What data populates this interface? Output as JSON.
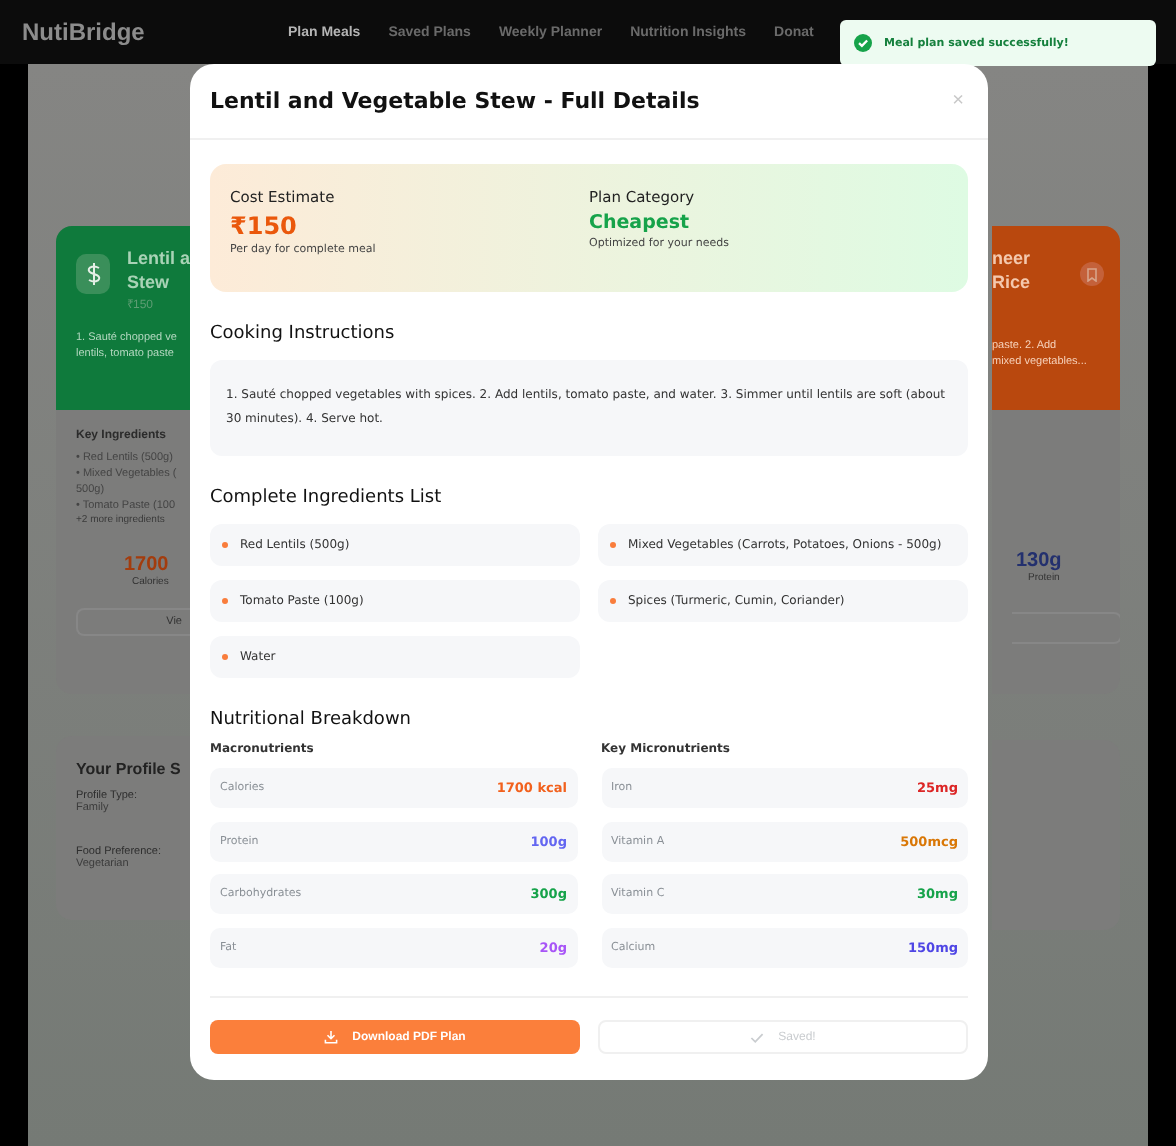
{
  "navbar": {
    "brand": "NutiBridge",
    "items": [
      {
        "label": "Plan Meals",
        "selected": true
      },
      {
        "label": "Saved Plans",
        "selected": false
      },
      {
        "label": "Weekly Planner",
        "selected": false
      },
      {
        "label": "Nutrition Insights",
        "selected": false
      },
      {
        "label": "Donat",
        "selected": false
      }
    ]
  },
  "background": {
    "left_card": {
      "title_lines": [
        "Lentil a",
        "Stew"
      ],
      "price": "₹150",
      "desc_lines": [
        "1. Sauté chopped ve",
        "lentils, tomato paste"
      ],
      "ingredients_title": "Key Ingredients",
      "ingredients": [
        "• Red Lentils (500g)",
        "• Mixed Vegetables (",
        "500g)",
        "• Tomato Paste (100"
      ],
      "more": "+2 more ingredients",
      "stat_value": "1700",
      "stat_label": "Calories",
      "button": "Vie"
    },
    "profile_card": {
      "title": "Your Profile S",
      "fields": [
        {
          "label": "Profile Type:",
          "value": "Family"
        },
        {
          "label": "Food Preference:",
          "value": "Vegetarian"
        }
      ]
    },
    "right_card": {
      "title_lines": [
        "neer",
        "Rice"
      ],
      "desc_lines": [
        "paste. 2. Add",
        "mixed vegetables..."
      ],
      "stat_value": "130g",
      "stat_label": "Protein"
    }
  },
  "toast": {
    "message": "Meal plan saved successfully!"
  },
  "modal": {
    "title": "Lentil and Vegetable Stew - Full Details",
    "close": "×",
    "summary": [
      {
        "label": "Cost Estimate",
        "value": "₹150",
        "note": "Per day for complete meal",
        "kind": "cost"
      },
      {
        "label": "Plan Category",
        "value": "Cheapest",
        "note": "Optimized for your needs",
        "kind": "category"
      }
    ],
    "instructions_title": "Cooking Instructions",
    "instructions": "1. Sauté chopped vegetables with spices. 2. Add lentils, tomato paste, and water. 3. Simmer until lentils are soft (about 30 minutes). 4. Serve hot.",
    "ingredients_title": "Complete Ingredients List",
    "ingredients": [
      "Red Lentils (500g)",
      "Mixed Vegetables (Carrots, Potatoes, Onions - 500g)",
      "Tomato Paste (100g)",
      "Spices (Turmeric, Cumin, Coriander)",
      "Water"
    ],
    "nutrition_title": "Nutritional Breakdown",
    "macro_title": "Macronutrients",
    "macronutrients": [
      {
        "name": "Calories",
        "value": "1700 kcal",
        "color": "#f2611d"
      },
      {
        "name": "Protein",
        "value": "100g",
        "color": "#6366f1"
      },
      {
        "name": "Carbohydrates",
        "value": "300g",
        "color": "#16a34a"
      },
      {
        "name": "Fat",
        "value": "20g",
        "color": "#a855f7"
      }
    ],
    "micro_title": "Key Micronutrients",
    "micronutrients": [
      {
        "name": "Iron",
        "value": "25mg",
        "color": "#dc2626"
      },
      {
        "name": "Vitamin A",
        "value": "500mcg",
        "color": "#d97706"
      },
      {
        "name": "Vitamin C",
        "value": "30mg",
        "color": "#16a34a"
      },
      {
        "name": "Calcium",
        "value": "150mg",
        "color": "#4f46e5"
      }
    ],
    "download_button": "Download PDF Plan",
    "saved_button": {
      "label": "Saved!",
      "disabled": true
    }
  }
}
